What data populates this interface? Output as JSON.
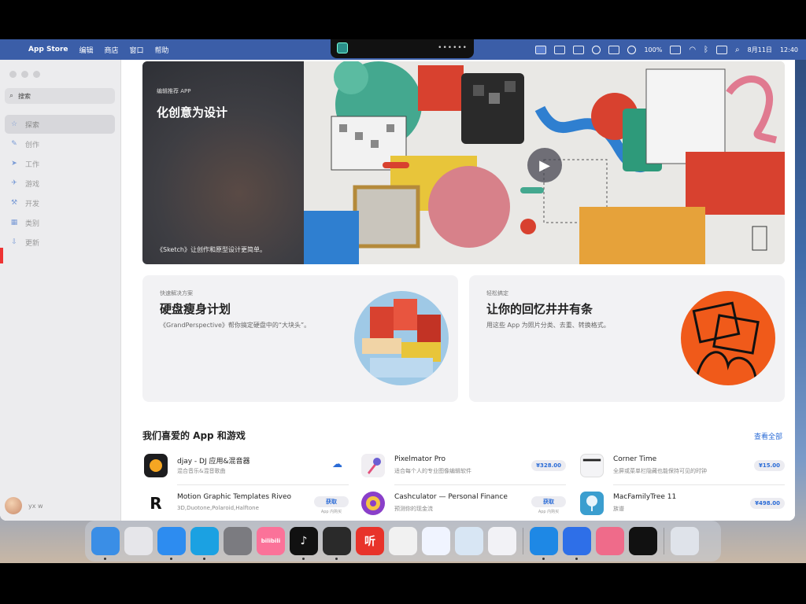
{
  "menubar": {
    "items": [
      "App Store",
      "编辑",
      "商店",
      "窗口",
      "帮助"
    ],
    "battery": "100%",
    "date": "8月11日",
    "time": "12:40"
  },
  "sidebar": {
    "search_placeholder": "搜索",
    "items": [
      {
        "label": "探索",
        "icon": "star-icon",
        "active": true
      },
      {
        "label": "创作",
        "icon": "brush-icon"
      },
      {
        "label": "工作",
        "icon": "paper-plane-icon"
      },
      {
        "label": "游戏",
        "icon": "rocket-icon"
      },
      {
        "label": "开发",
        "icon": "hammer-icon"
      },
      {
        "label": "类别",
        "icon": "grid-icon"
      },
      {
        "label": "更新",
        "icon": "download-icon"
      }
    ],
    "user": "yx w"
  },
  "hero": {
    "eyebrow": "编辑推荐 APP",
    "title": "化创意为设计",
    "description": "《Sketch》让创作和原型设计更简单。"
  },
  "cards": [
    {
      "eyebrow": "快速解决方案",
      "title": "硬盘瘦身计划",
      "description": "《GrandPerspective》帮你搞定硬盘中的“大块头”。"
    },
    {
      "eyebrow": "轻松搞定",
      "title": "让你的回忆井井有条",
      "description": "用这些 App 为照片分类、去重、转换格式。"
    }
  ],
  "apps_section": {
    "title": "我们喜爱的 App 和游戏",
    "see_all": "查看全部",
    "apps": [
      {
        "name": "djay - DJ 应用&混音器",
        "sub": "混合音乐&混音歌曲",
        "action": "cloud",
        "color": "#1d1d1f"
      },
      {
        "name": "Pixelmator Pro",
        "sub": "适合每个人的专业图像编辑软件",
        "action": "price",
        "price": "¥328.00",
        "color": "#f0eef2"
      },
      {
        "name": "Corner Time",
        "sub": "全屏或菜单栏隐藏也能保持可见的时钟",
        "action": "price",
        "price": "¥15.00",
        "color": "#f4f4f6"
      },
      {
        "name": "Motion Graphic Templates Riveo",
        "sub": "3D,Duotone,Polaroid,Halftone",
        "action": "get",
        "get": "获取",
        "iap": "App 内购买",
        "color": "#ffffff"
      },
      {
        "name": "Cashculator — Personal Finance",
        "sub": "预测你的现金流",
        "action": "get",
        "get": "获取",
        "iap": "App 内购买",
        "color": "#8a3fc9"
      },
      {
        "name": "MacFamilyTree 11",
        "sub": "族谱",
        "action": "price",
        "price": "¥498.00",
        "color": "#3b9ecf"
      }
    ]
  },
  "dock": [
    {
      "name": "finder-icon",
      "color": "#3a8ee6"
    },
    {
      "name": "launchpad-icon",
      "color": "#e6e6ea"
    },
    {
      "name": "app-store-icon",
      "color": "#2d8cf0"
    },
    {
      "name": "edge-icon",
      "color": "#1ba1e2"
    },
    {
      "name": "system-settings-icon",
      "color": "#7b7b80"
    },
    {
      "name": "bilibili-icon",
      "color": "#fb7299",
      "label": "bilibili"
    },
    {
      "name": "tiktok-icon",
      "color": "#111111",
      "label": "♪"
    },
    {
      "name": "audio-editor-icon",
      "color": "#2a2a2a"
    },
    {
      "name": "ting-icon",
      "color": "#e8332a",
      "label": "听"
    },
    {
      "name": "video-player-icon",
      "color": "#f1f1f1"
    },
    {
      "name": "feishu-icon",
      "color": "#f0f4ff"
    },
    {
      "name": "remote-desktop-icon",
      "color": "#d8e6f4"
    },
    {
      "name": "cloud-app-icon",
      "color": "#f2f2f6"
    },
    {
      "name": "windows-icon",
      "color": "#1e88e5"
    },
    {
      "name": "quark-icon",
      "color": "#2e6fe8"
    },
    {
      "name": "screen-icon",
      "color": "#ef6b8a"
    },
    {
      "name": "capcut-icon",
      "color": "#111111"
    },
    {
      "name": "trash-icon",
      "color": "#dfe3ea"
    }
  ]
}
